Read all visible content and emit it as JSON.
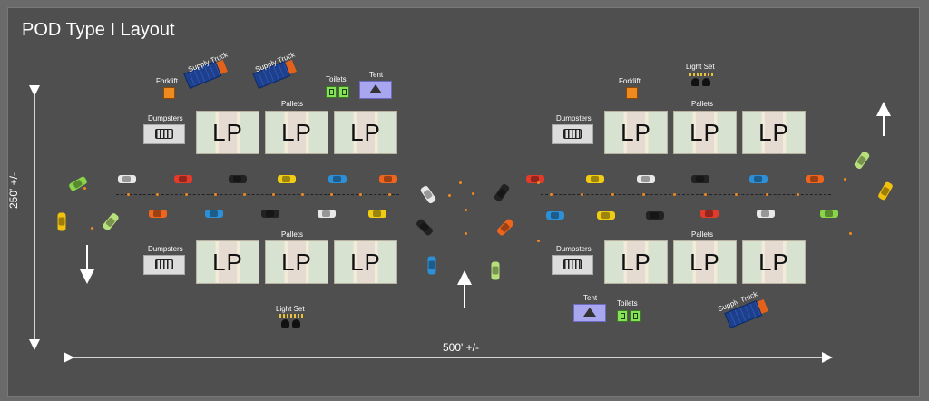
{
  "title": "POD Type I Layout",
  "dimensions": {
    "height": "250' +/-",
    "width": "500' +/-"
  },
  "labels": {
    "lp": "LP",
    "pallets": "Pallets",
    "dumpsters": "Dumpsters",
    "forklift": "Forklift",
    "supply_truck": "Supply Truck",
    "toilets": "Toilets",
    "tent": "Tent",
    "light_set": "Light Set"
  },
  "colors": {
    "background": "#4f4f4f",
    "lp_pad": "#f2ebd9",
    "tent": "#a8a6ef",
    "toilet": "#86e05a",
    "forklift": "#f08a1e",
    "truck_box": "#1e3f8c",
    "truck_cab": "#e2621b",
    "cone": "#f08a1e"
  },
  "car_colors": [
    "#8ad44a",
    "#f2c10e",
    "#e8e8e8",
    "#e23b2b",
    "#222222",
    "#f0cd14",
    "#2d8fd6",
    "#f0651e",
    "#b8e07a"
  ]
}
